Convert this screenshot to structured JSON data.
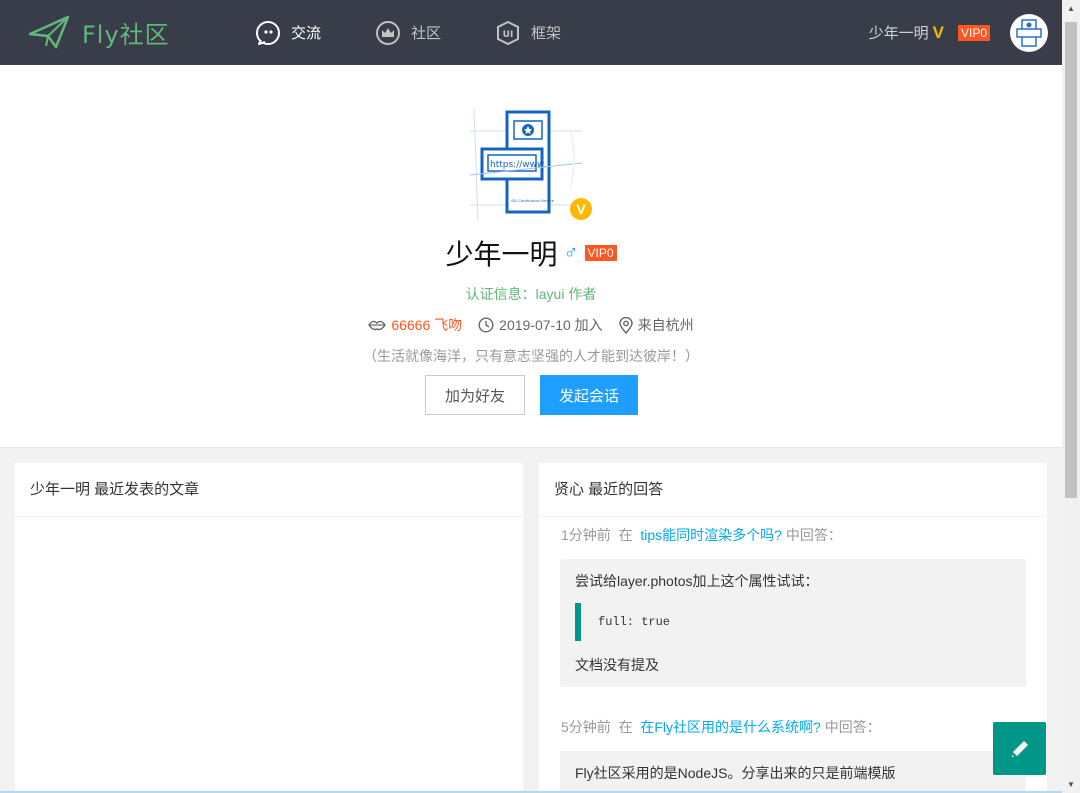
{
  "header": {
    "logo_text": "Fly社区",
    "nav": [
      {
        "label": "交流",
        "icon": "chat-bubble-icon"
      },
      {
        "label": "社区",
        "icon": "crown-icon"
      },
      {
        "label": "框架",
        "icon": "ui-shield-icon"
      }
    ],
    "user_name": "少年一明",
    "verified_mark": "V",
    "vip_label": "VIP0"
  },
  "profile": {
    "name": "少年一明",
    "gender_symbol": "♂",
    "vip_label": "VIP0",
    "verified_badge": "V",
    "verify_info": "认证信息：layui 作者",
    "kiss_count": "66666 飞吻",
    "join_date": "2019-07-10 加入",
    "location": "来自杭州",
    "signature": "（生活就像海洋，只有意志坚强的人才能到达彼岸！）",
    "add_friend_label": "加为好友",
    "start_chat_label": "发起会话"
  },
  "left_panel": {
    "title": "少年一明 最近发表的文章"
  },
  "right_panel": {
    "title": "贤心 最近的回答",
    "answers": [
      {
        "time": "1分钟前",
        "prefix": "在",
        "topic": "tips能同时渲染多个吗?",
        "suffix": "中回答：",
        "line1": "尝试给layer.photos加上这个属性试试：",
        "code": "full: true",
        "line2": "文档没有提及"
      },
      {
        "time": "5分钟前",
        "prefix": "在",
        "topic": "在Fly社区用的是什么系统啊?",
        "suffix": "中回答：",
        "line1": "Fly社区采用的是NodeJS。分享出来的只是前端模版"
      }
    ]
  },
  "colors": {
    "header_bg": "#393d49",
    "brand_green": "#5fb878",
    "vip_orange": "#ff5722",
    "primary_blue": "#1e9fff",
    "link_blue": "#01aaed",
    "teal": "#009688",
    "gold": "#ffb800"
  },
  "fab_icon": "edit-pencil-icon"
}
